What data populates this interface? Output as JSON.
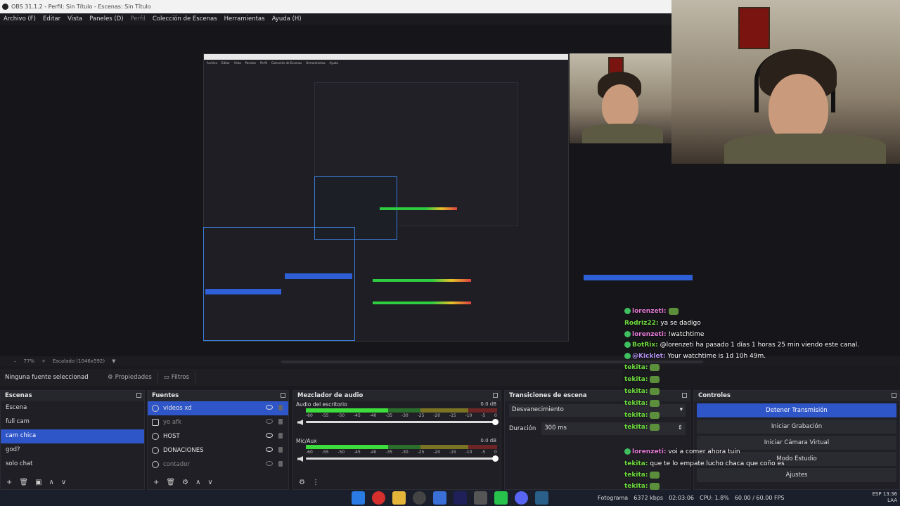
{
  "window": {
    "title": "OBS 31.1.2 - Perfil: Sin Título - Escenas: Sin Título"
  },
  "menu": [
    "Archivo (F)",
    "Editar",
    "Vista",
    "Paneles (D)",
    "Perfil",
    "Colección de Escenas",
    "Herramientas",
    "Ayuda (H)"
  ],
  "preview": {
    "zoom": "77%",
    "scale_label": "Escalado (1046x592)"
  },
  "props_bar": {
    "label": "Ninguna fuente seleccionad",
    "properties": "Propiedades",
    "filters": "Filtros"
  },
  "scenes": {
    "title": "Escenas",
    "items": [
      "Escena",
      "full cam",
      "cam chica",
      "god?",
      "solo chat"
    ],
    "selected_index": 2
  },
  "sources": {
    "title": "Fuentes",
    "items": [
      {
        "name": "videos xd",
        "visible": true
      },
      {
        "name": "yo afk",
        "visible": false
      },
      {
        "name": "HOST",
        "visible": true
      },
      {
        "name": "DONACIONES",
        "visible": true
      },
      {
        "name": "contador",
        "visible": false
      }
    ],
    "selected_index": 0
  },
  "mixer": {
    "title": "Mezclador de audio",
    "channels": [
      {
        "name": "Audio del escritorio",
        "db": "0.0 dB",
        "level": 0.43
      },
      {
        "name": "Mic/Aux",
        "db": "0.0 dB",
        "level": 0.43
      }
    ],
    "scale": [
      "-60",
      "-55",
      "-50",
      "-45",
      "-40",
      "-35",
      "-30",
      "-25",
      "-20",
      "-15",
      "-10",
      "-5",
      "0"
    ]
  },
  "transitions": {
    "title": "Transiciones de escena",
    "current": "Desvanecimiento",
    "duration_label": "Duración",
    "duration_value": "300 ms"
  },
  "controls": {
    "title": "Controles",
    "buttons": [
      "Detener Transmisión",
      "Iniciar Grabación",
      "Iniciar Cámara Virtual",
      "Modo Estudio",
      "Ajustes"
    ]
  },
  "chat": [
    {
      "user": "lorenzeti:",
      "color": "pink",
      "msg": ""
    },
    {
      "user": "Rodriz22:",
      "color": "green",
      "msg": "ya se dadigo"
    },
    {
      "user": "lorenzeti:",
      "color": "pink",
      "msg": "!watchtime"
    },
    {
      "user": "BotRix:",
      "color": "green",
      "msg": "@lorenzeti ha pasado 1 días 1 horas 25 min viendo este canal."
    },
    {
      "user": "@Kicklet:",
      "color": "blue",
      "msg": "Your watchtime is 1d 10h 49m."
    },
    {
      "user": "tekita:",
      "color": "green",
      "msg": ""
    },
    {
      "user": "tekita:",
      "color": "green",
      "msg": ""
    },
    {
      "user": "tekita:",
      "color": "green",
      "msg": ""
    },
    {
      "user": "tekita:",
      "color": "green",
      "msg": ""
    },
    {
      "user": "tekita:",
      "color": "green",
      "msg": ""
    },
    {
      "user": "tekita:",
      "color": "green",
      "msg": ""
    },
    {
      "user": "lorenzeti:",
      "color": "pink",
      "msg": "voi a comer ahora tuin"
    },
    {
      "user": "tekita:",
      "color": "green",
      "msg": "que te lo empate lucho chaca que coño es"
    },
    {
      "user": "tekita:",
      "color": "green",
      "msg": ""
    },
    {
      "user": "tekita:",
      "color": "green",
      "msg": ""
    }
  ],
  "status": {
    "frames": "Fotograma",
    "bitrate": "6372 kbps",
    "time": "02:03:06",
    "cpu": "CPU: 1.8%",
    "fps": "60.00 / 60.00 FPS"
  },
  "tray": {
    "lang": "ESP",
    "layout": "LAA",
    "clock": "13:36"
  },
  "colors": {
    "accent": "#2f56c8",
    "chat_green": "#6fdc3f",
    "chat_pink": "#e37ad3"
  }
}
